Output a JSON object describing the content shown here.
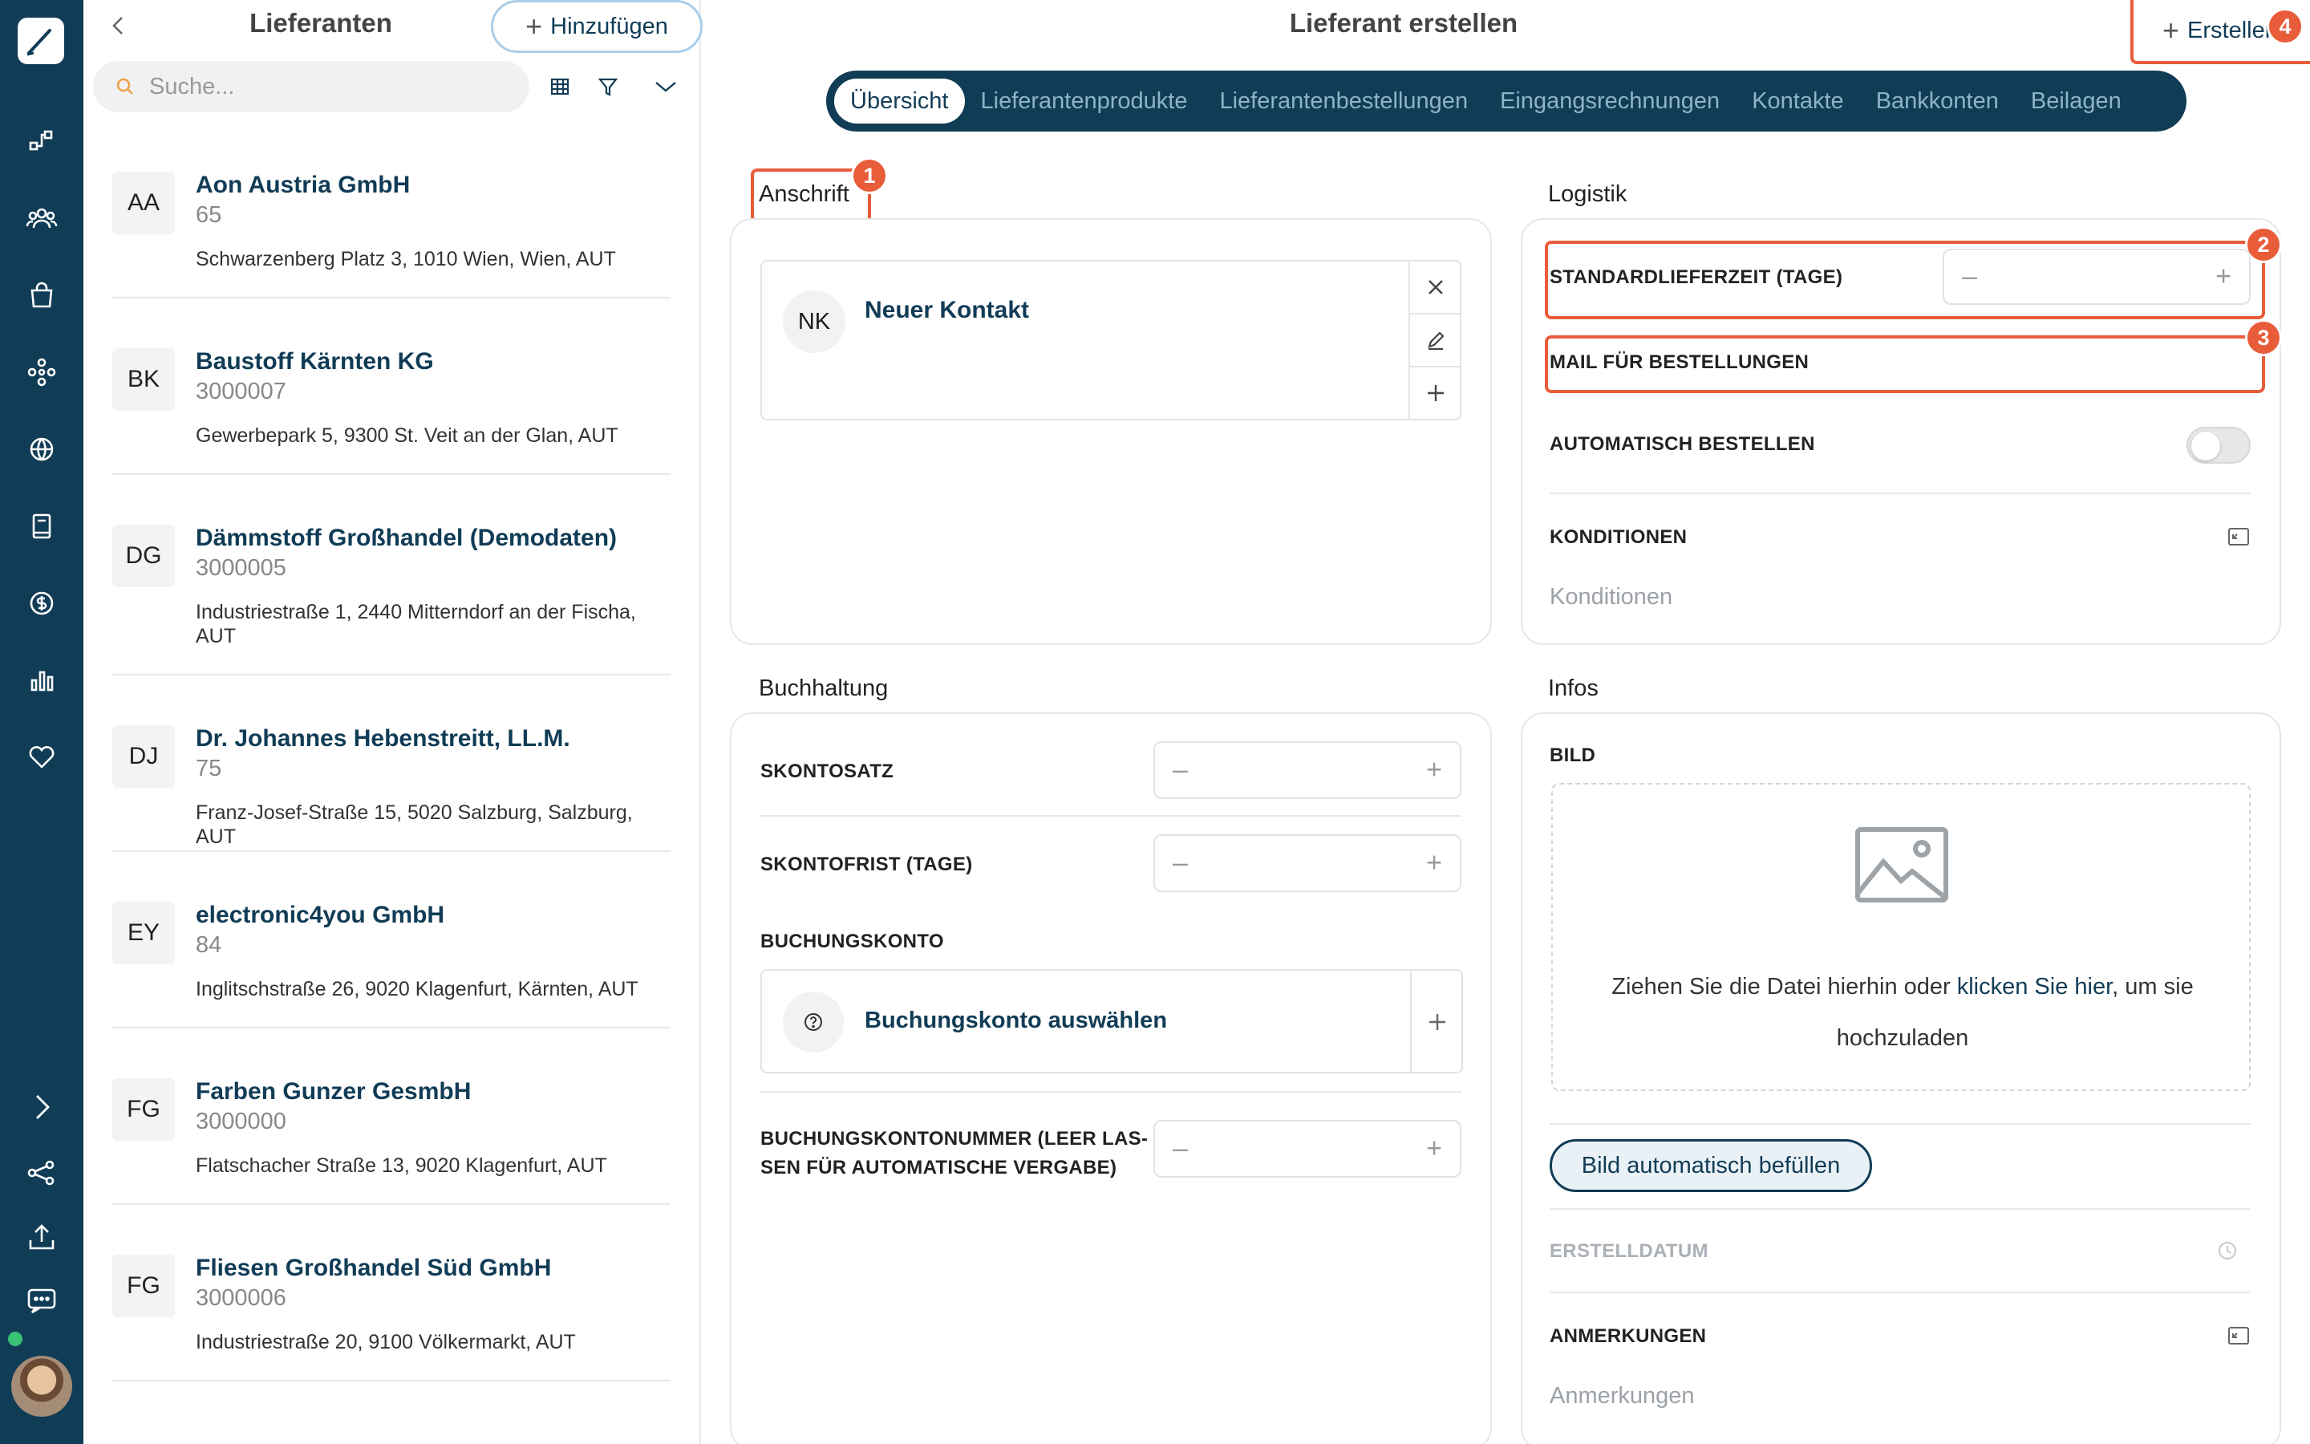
{
  "colors": {
    "rail": "#113c56",
    "accent": "#113c56",
    "highlight": "#e85c3a",
    "online": "#38c172"
  },
  "list": {
    "title": "Lieferanten",
    "add_label": "Hinzufügen",
    "search_placeholder": "Suche...",
    "items": [
      {
        "initials": "AA",
        "name": "Aon Austria GmbH",
        "number": "65",
        "address": "Schwarzenberg Platz 3, 1010 Wien, Wien, AUT"
      },
      {
        "initials": "BK",
        "name": "Baustoff Kärnten KG",
        "number": "3000007",
        "address": "Gewerbepark 5, 9300 St. Veit an der Glan, AUT"
      },
      {
        "initials": "DG",
        "name": "Dämmstoff Großhandel (Demodaten)",
        "number": "3000005",
        "address": "Industriestraße 1, 2440 Mitterndorf an der Fischa, AUT"
      },
      {
        "initials": "DJ",
        "name": "Dr. Johannes Hebenstreitt, LL.M.",
        "number": "75",
        "address": "Franz-Josef-Straße 15, 5020 Salzburg, Salzburg, AUT"
      },
      {
        "initials": "EY",
        "name": "electronic4you GmbH",
        "number": "84",
        "address": "Inglitschstraße 26, 9020 Klagenfurt, Kärnten, AUT"
      },
      {
        "initials": "FG",
        "name": "Farben Gunzer GesmbH",
        "number": "3000000",
        "address": "Flatschacher Straße 13, 9020 Klagenfurt, AUT"
      },
      {
        "initials": "FG",
        "name": "Fliesen Großhandel Süd GmbH",
        "number": "3000006",
        "address": "Industriestraße 20, 9100 Völkermarkt, AUT"
      }
    ]
  },
  "main": {
    "title": "Lieferant erstellen",
    "create_label": "Erstellen",
    "tabs": [
      "Übersicht",
      "Lieferantenprodukte",
      "Lieferantenbestellungen",
      "Eingangsrechnungen",
      "Kontakte",
      "Bankkonten",
      "Beilagen"
    ],
    "badges": [
      "1",
      "2",
      "3",
      "4"
    ],
    "anschrift": {
      "title": "Anschrift",
      "contact_initials": "NK",
      "contact_name": "Neuer Kontakt"
    },
    "logistik": {
      "title": "Logistik",
      "lieferzeit": "STANDARDLIEFERZEIT (TAGE)",
      "mail": "MAIL FÜR BESTELLUNGEN",
      "auto": "AUTOMATISCH BESTELLEN",
      "konditionen": "KONDITIONEN",
      "konditionen_placeholder": "Konditionen"
    },
    "buchhaltung": {
      "title": "Buchhaltung",
      "skontosatz": "SKONTOSATZ",
      "skontofrist": "SKONTOFRIST (TAGE)",
      "buchungskonto": "BUCHUNGSKONTO",
      "buchungskonto_select": "Buchungskonto auswählen",
      "nummer_l1": "BUCHUNGSKONTONUMMER (LEER LAS-",
      "nummer_l2": "SEN FÜR AUTOMATISCHE VERGABE)"
    },
    "infos": {
      "title": "Infos",
      "bild": "BILD",
      "drop_pre": "Ziehen Sie die Datei hierhin oder ",
      "drop_link": "klicken Sie hier",
      "drop_post": ", um sie",
      "drop_l2": "hochzuladen",
      "auto_fill": "Bild automatisch befüllen",
      "erstelldatum": "ERSTELLDATUM",
      "anmerkungen": "ANMERKUNGEN",
      "anmerkungen_placeholder": "Anmerkungen"
    }
  }
}
